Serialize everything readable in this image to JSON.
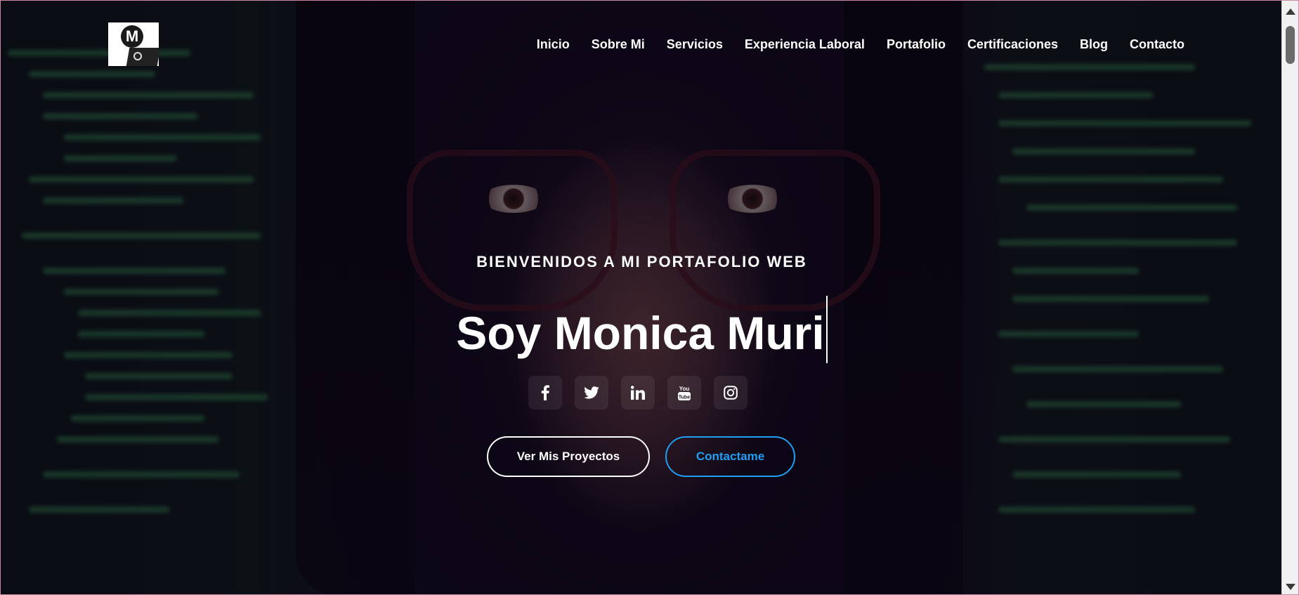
{
  "header": {
    "logo_alt": "M logo",
    "logo_letter": "M",
    "nav": [
      {
        "label": "Inicio"
      },
      {
        "label": "Sobre Mi"
      },
      {
        "label": "Servicios"
      },
      {
        "label": "Experiencia Laboral"
      },
      {
        "label": "Portafolio"
      },
      {
        "label": "Certificaciones"
      },
      {
        "label": "Blog"
      },
      {
        "label": "Contacto"
      }
    ]
  },
  "hero": {
    "welcome": "BIENVENIDOS A MI PORTAFOLIO WEB",
    "prefix": "Soy",
    "name": "Monica Muri",
    "socials": [
      {
        "icon": "facebook-icon"
      },
      {
        "icon": "twitter-icon"
      },
      {
        "icon": "linkedin-icon"
      },
      {
        "icon": "youtube-icon"
      },
      {
        "icon": "instagram-icon"
      }
    ],
    "buttons": {
      "projects": "Ver Mis Proyectos",
      "contact": "Contactame"
    }
  },
  "colors": {
    "accent": "#1e9ff2",
    "text": "#ffffff"
  }
}
